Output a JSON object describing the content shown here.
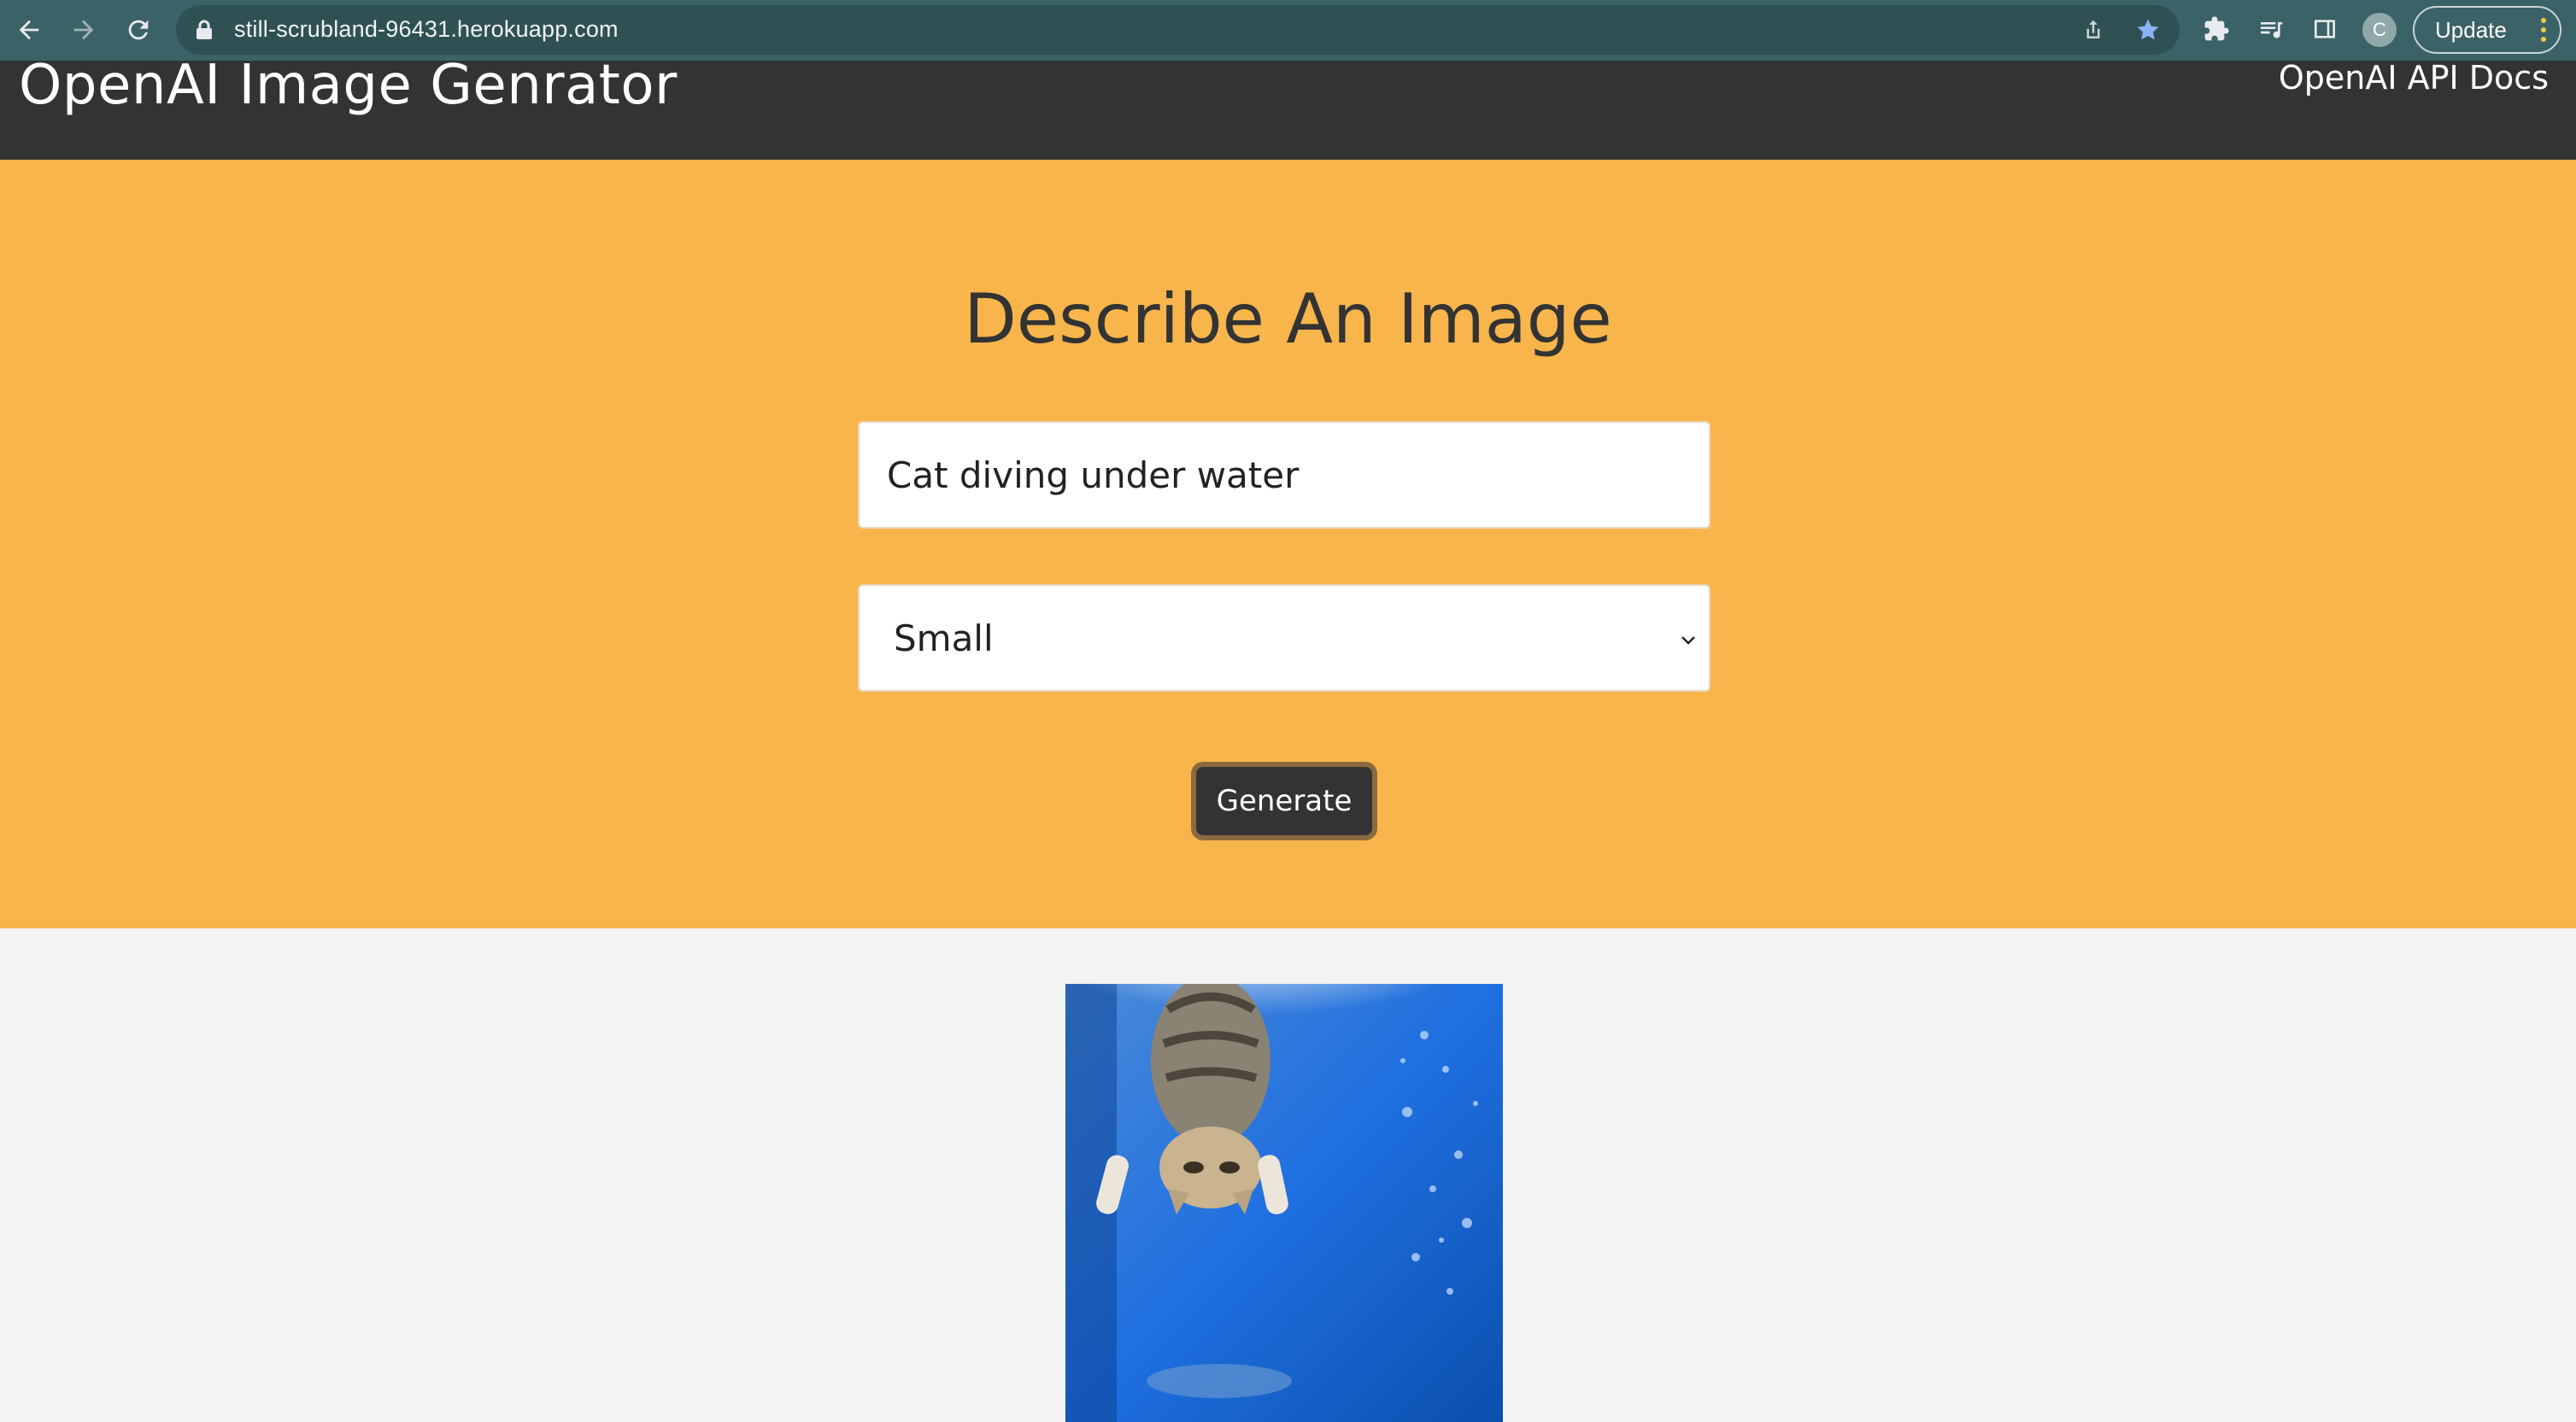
{
  "browser": {
    "url": "still-scrubland-96431.herokuapp.com",
    "profile_initial": "C",
    "update_label": "Update"
  },
  "header": {
    "brand": "OpenAI Image Genrator",
    "docs_link": "OpenAI API Docs"
  },
  "showcase": {
    "heading": "Describe An Image",
    "prompt_value": "Cat diving under water",
    "size_selected": "Small",
    "generate_label": "Generate"
  },
  "result": {
    "image_subject": "cat-diving-underwater-image"
  },
  "colors": {
    "chrome": "#3b6266",
    "header": "#333333",
    "accent": "#f8b54c",
    "background": "#f4f4f4"
  }
}
